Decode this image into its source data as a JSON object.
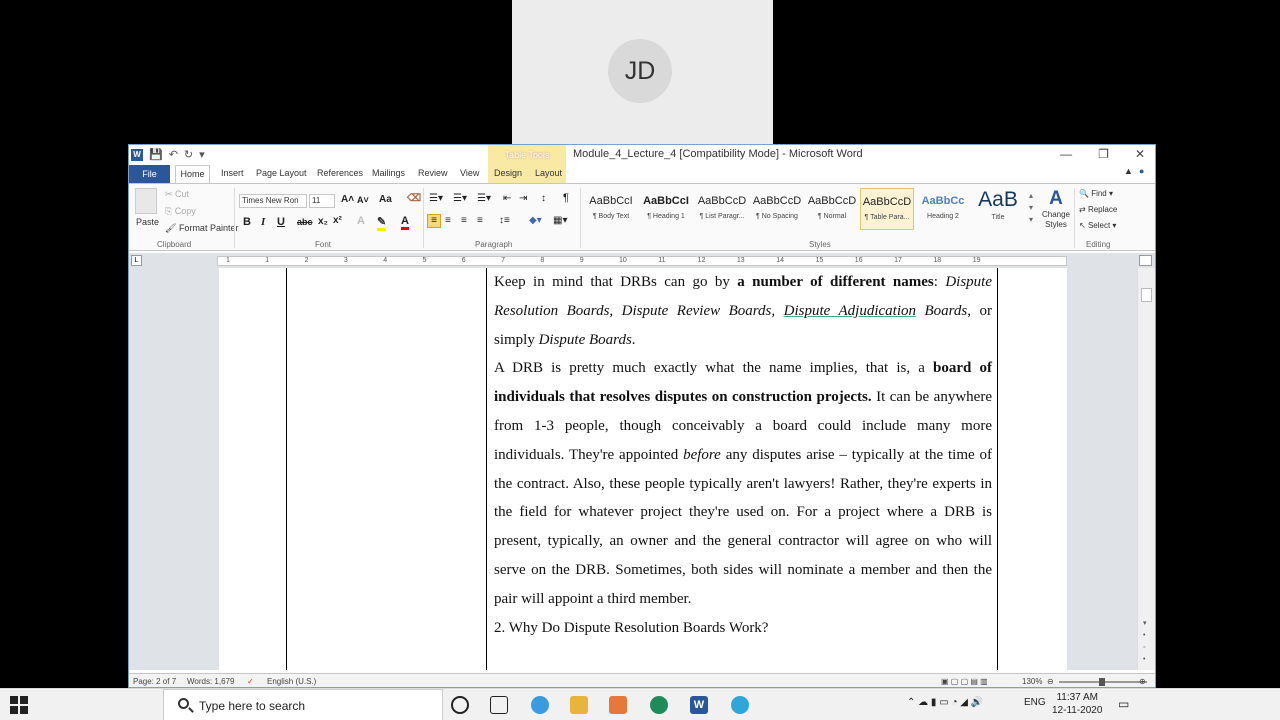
{
  "call": {
    "avatar_initials": "JD"
  },
  "titlebar": {
    "doc_title": "Module_4_Lecture_4 [Compatibility Mode] - Microsoft Word",
    "table_tools": "Table Tools",
    "minimize": "—",
    "restore": "❐",
    "close": "✕"
  },
  "tabs": {
    "file": "File",
    "home": "Home",
    "insert": "Insert",
    "page_layout": "Page Layout",
    "references": "References",
    "mailings": "Mailings",
    "review": "Review",
    "view": "View",
    "design": "Design",
    "layout": "Layout"
  },
  "ribbon": {
    "clipboard": {
      "paste": "Paste",
      "cut": "Cut",
      "copy": "Copy",
      "format_painter": "Format Painter",
      "label": "Clipboard"
    },
    "font": {
      "family": "Times New Ron",
      "size": "11",
      "label": "Font"
    },
    "paragraph": {
      "label": "Paragraph"
    },
    "styles": {
      "label": "Styles",
      "items": [
        {
          "preview": "AaBbCcI",
          "name": "¶ Body Text"
        },
        {
          "preview": "AaBbCcI",
          "name": "¶ Heading 1"
        },
        {
          "preview": "AaBbCcD",
          "name": "¶ List Paragr..."
        },
        {
          "preview": "AaBbCcD",
          "name": "¶ No Spacing"
        },
        {
          "preview": "AaBbCcD",
          "name": "¶ Normal"
        },
        {
          "preview": "AaBbCcD",
          "name": "¶ Table Para..."
        },
        {
          "preview": "AaBbCc",
          "name": "Heading 2"
        },
        {
          "preview": "AaB",
          "name": "Title"
        }
      ],
      "change_styles": "Change Styles"
    },
    "editing": {
      "find": "Find",
      "replace": "Replace",
      "select": "Select",
      "label": "Editing"
    }
  },
  "ruler": {
    "numbers": [
      "1",
      "1",
      "2",
      "3",
      "4",
      "5",
      "6",
      "7",
      "8",
      "9",
      "10",
      "11",
      "12",
      "13",
      "14",
      "15",
      "16",
      "17",
      "18",
      "19"
    ]
  },
  "document": {
    "p1_a": "Keep in mind that DRBs can go by ",
    "p1_b": "a number of different names",
    "p1_c": ":",
    "p1_d": "Dispute Resolution Boards, Dispute Review Boards, ",
    "p1_e": "Dispute Adjudication",
    "p1_f": " Boards",
    "p1_g": ",  or simply ",
    "p1_h": "Dispute Boards",
    "p1_i": ".",
    "p2_a": "A DRB is pretty much exactly what the name implies, that is, a ",
    "p2_b": "board of individuals that resolves disputes on construction projects.",
    "p2_c": " It can be anywhere from 1-3 people, though conceivably a board could include many more individuals. They're appointed ",
    "p2_d": "before",
    "p2_e": " any disputes arise – typically at the time of the contract. Also, these people typically aren't lawyers! Rather, they're experts in the field for whatever project they're used on. For a project where a DRB is present, typically, an owner and the general contractor will agree on who will serve on the DRB. Sometimes, both sides will nominate a member and then the pair will appoint a third member.",
    "heading": "2. Why Do Dispute Resolution Boards Work?"
  },
  "status": {
    "page": "Page: 2 of 7",
    "words": "Words: 1,679",
    "language": "English (U.S.)",
    "zoom": "130%"
  },
  "taskbar": {
    "search_placeholder": "Type here to search",
    "lang": "ENG",
    "time": "11:37 AM",
    "date": "12-11-2020"
  }
}
